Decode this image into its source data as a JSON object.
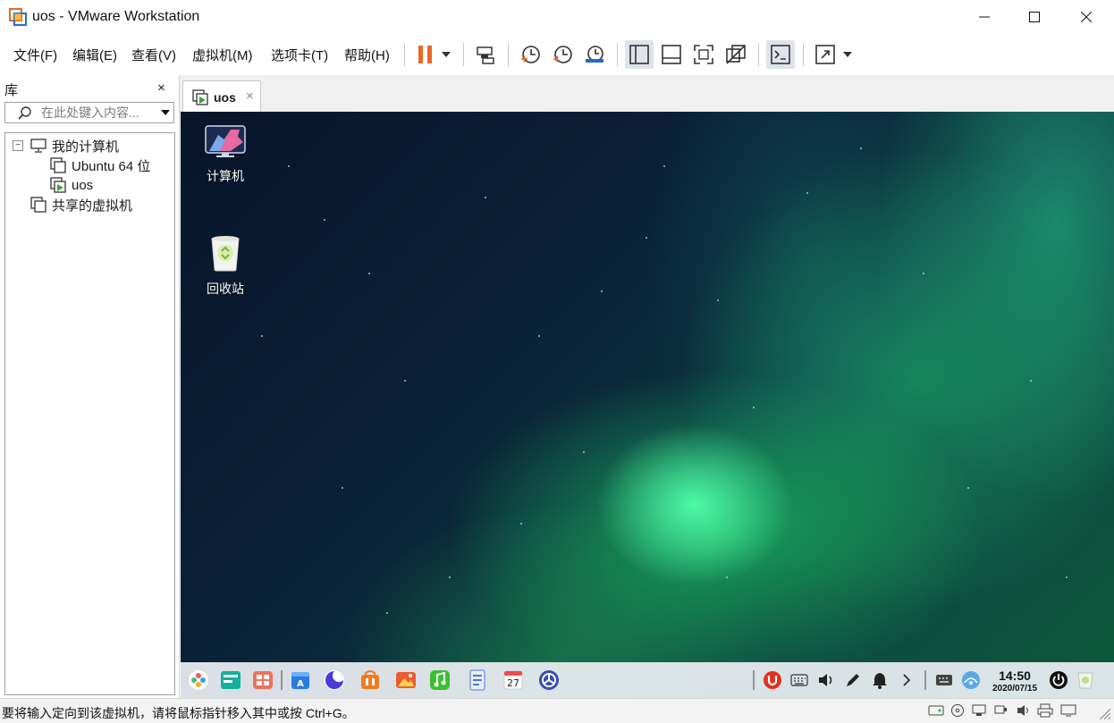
{
  "window": {
    "title": "uos - VMware Workstation"
  },
  "menu": [
    "文件(F)",
    "编辑(E)",
    "查看(V)",
    "虚拟机(M)",
    "选项卡(T)",
    "帮助(H)"
  ],
  "toolbar": {
    "icons": [
      "pause-icon",
      "dropdown-icon",
      "send-ctrl-alt-del-icon",
      "snapshot-icon",
      "revert-snapshot-icon",
      "snapshot-manager-icon",
      "show-library-icon",
      "thumbnail-bar-icon",
      "full-screen-icon",
      "unity-icon",
      "console-view-icon",
      "stretch-guest-icon",
      "dropdown-icon"
    ],
    "active": [
      "show-library-icon",
      "console-view-icon"
    ]
  },
  "library": {
    "title": "库",
    "close": "×",
    "search_placeholder": "在此处键入内容...",
    "tree": {
      "collapse_sign": "−",
      "root": "我的计算机",
      "vms": [
        "Ubuntu 64 位",
        "uos"
      ],
      "shared": "共享的虚拟机"
    }
  },
  "tab": {
    "label": "uos",
    "close": "×"
  },
  "desktop": {
    "icons": [
      {
        "label": "计算机"
      },
      {
        "label": "回收站"
      }
    ]
  },
  "dock": {
    "apps": [
      "launcher-icon",
      "multitasking-view-icon",
      "file-manager-icon",
      "app-store-icon",
      "browser-icon",
      "deepin-store-icon",
      "image-viewer-icon",
      "music-icon",
      "document-viewer-icon",
      "calendar-icon",
      "settings-icon"
    ],
    "calendar_day": "27",
    "tray": [
      "uos-id-icon",
      "keyboard-icon",
      "volume-icon",
      "pen-icon",
      "notification-icon",
      "chevron-right-icon",
      "onscreen-keyboard-icon",
      "network-icon"
    ],
    "time": "14:50",
    "date": "2020/07/15",
    "power": "power-icon",
    "trash": "dock-trash-icon"
  },
  "status": {
    "message": "要将输入定向到该虚拟机，请将鼠标指针移入其中或按 Ctrl+G。",
    "device_icons": [
      "hard-disk-icon",
      "cd-icon",
      "network-adapter-icon",
      "usb-icon",
      "sound-icon",
      "printer-icon",
      "display-icon"
    ]
  },
  "colors": {
    "pause": "#e8672a",
    "accent": "#1e6fd0",
    "vm_play": "#3aa63a"
  }
}
